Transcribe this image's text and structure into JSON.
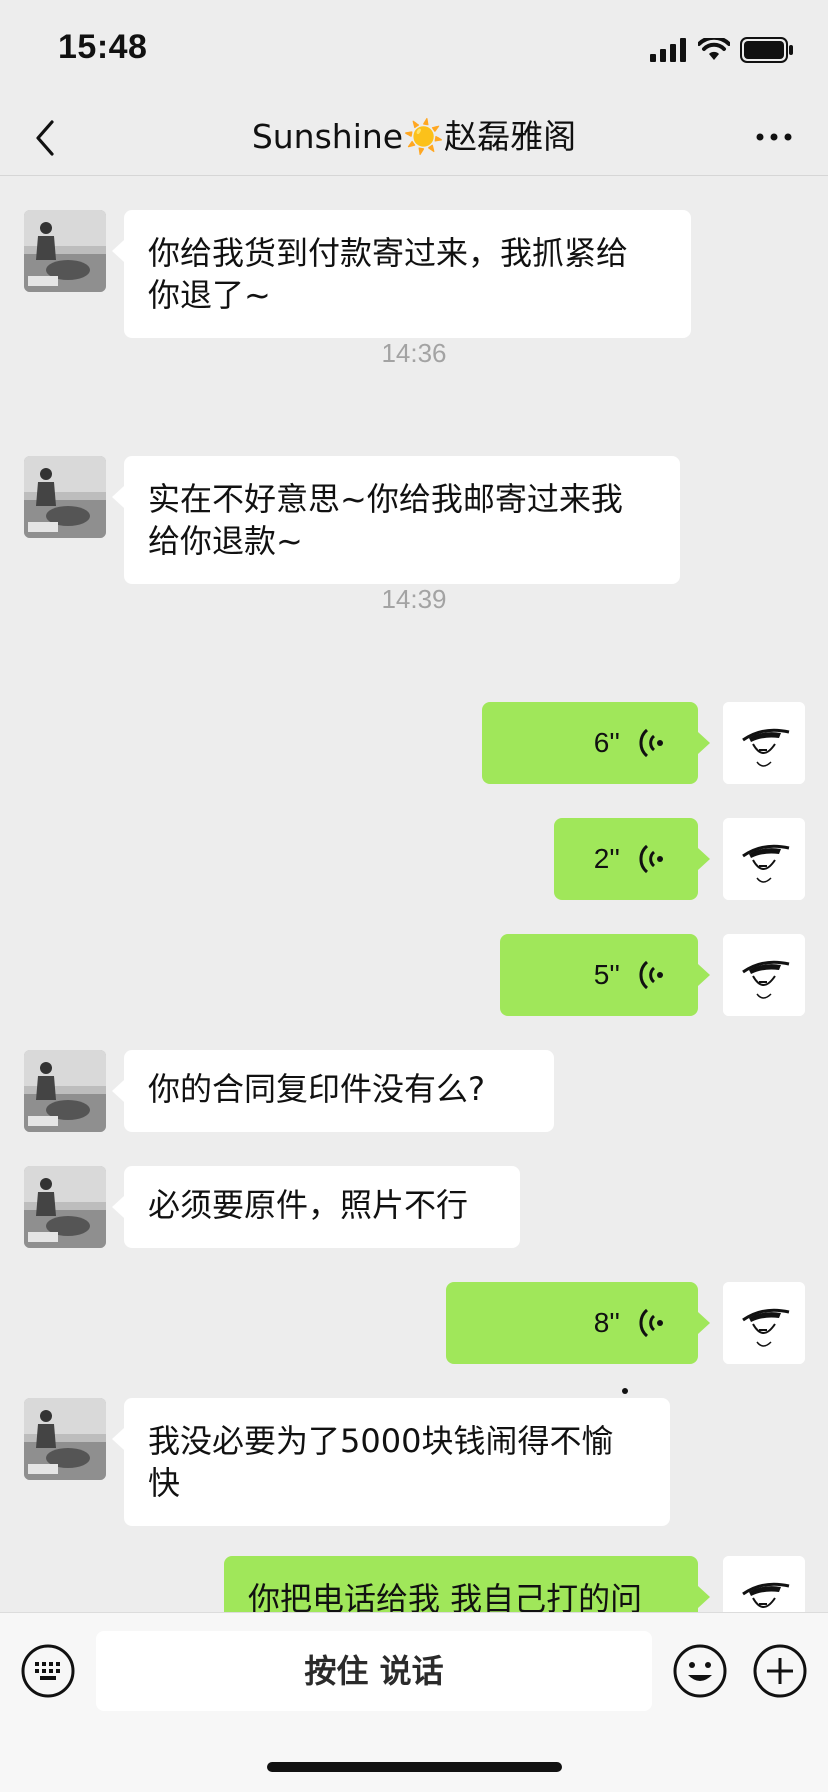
{
  "status_bar": {
    "time": "15:48"
  },
  "nav": {
    "title": "Sunshine☀️赵磊雅阁"
  },
  "messages": [
    {
      "type": "text",
      "side": "in",
      "lines": [
        "你给我货到付款寄过来，我抓紧给",
        "你退了~"
      ]
    },
    {
      "type": "timestamp",
      "text": "14:36"
    },
    {
      "type": "text",
      "side": "in",
      "lines": [
        "实在不好意思~你给我邮寄过来我",
        "给你退款~"
      ]
    },
    {
      "type": "timestamp",
      "text": "14:39"
    },
    {
      "type": "voice",
      "side": "out",
      "duration": "6''"
    },
    {
      "type": "voice",
      "side": "out",
      "duration": "2''"
    },
    {
      "type": "voice",
      "side": "out",
      "duration": "5''"
    },
    {
      "type": "text",
      "side": "in",
      "lines": [
        "你的合同复印件没有么?"
      ]
    },
    {
      "type": "text",
      "side": "in",
      "lines": [
        "必须要原件，照片不行"
      ]
    },
    {
      "type": "voice",
      "side": "out",
      "duration": "8''"
    },
    {
      "type": "text",
      "side": "in",
      "lines": [
        "我没必要为了5000块钱闹得不愉",
        "快"
      ]
    },
    {
      "type": "text",
      "side": "out",
      "lines": [
        "你把电话给我 我自己打的问"
      ]
    }
  ],
  "input_bar": {
    "hold_to_talk": "按住 说话"
  },
  "icons": {
    "back": "chevron-left-icon",
    "more": "ellipsis-icon",
    "keyboard": "keyboard-icon",
    "emoji": "smiley-icon",
    "plus": "plus-circle-icon",
    "voice": "voice-wave-icon"
  },
  "colors": {
    "outgoing_bubble": "#a0e75a",
    "incoming_bubble": "#ffffff",
    "background": "#ededed"
  }
}
